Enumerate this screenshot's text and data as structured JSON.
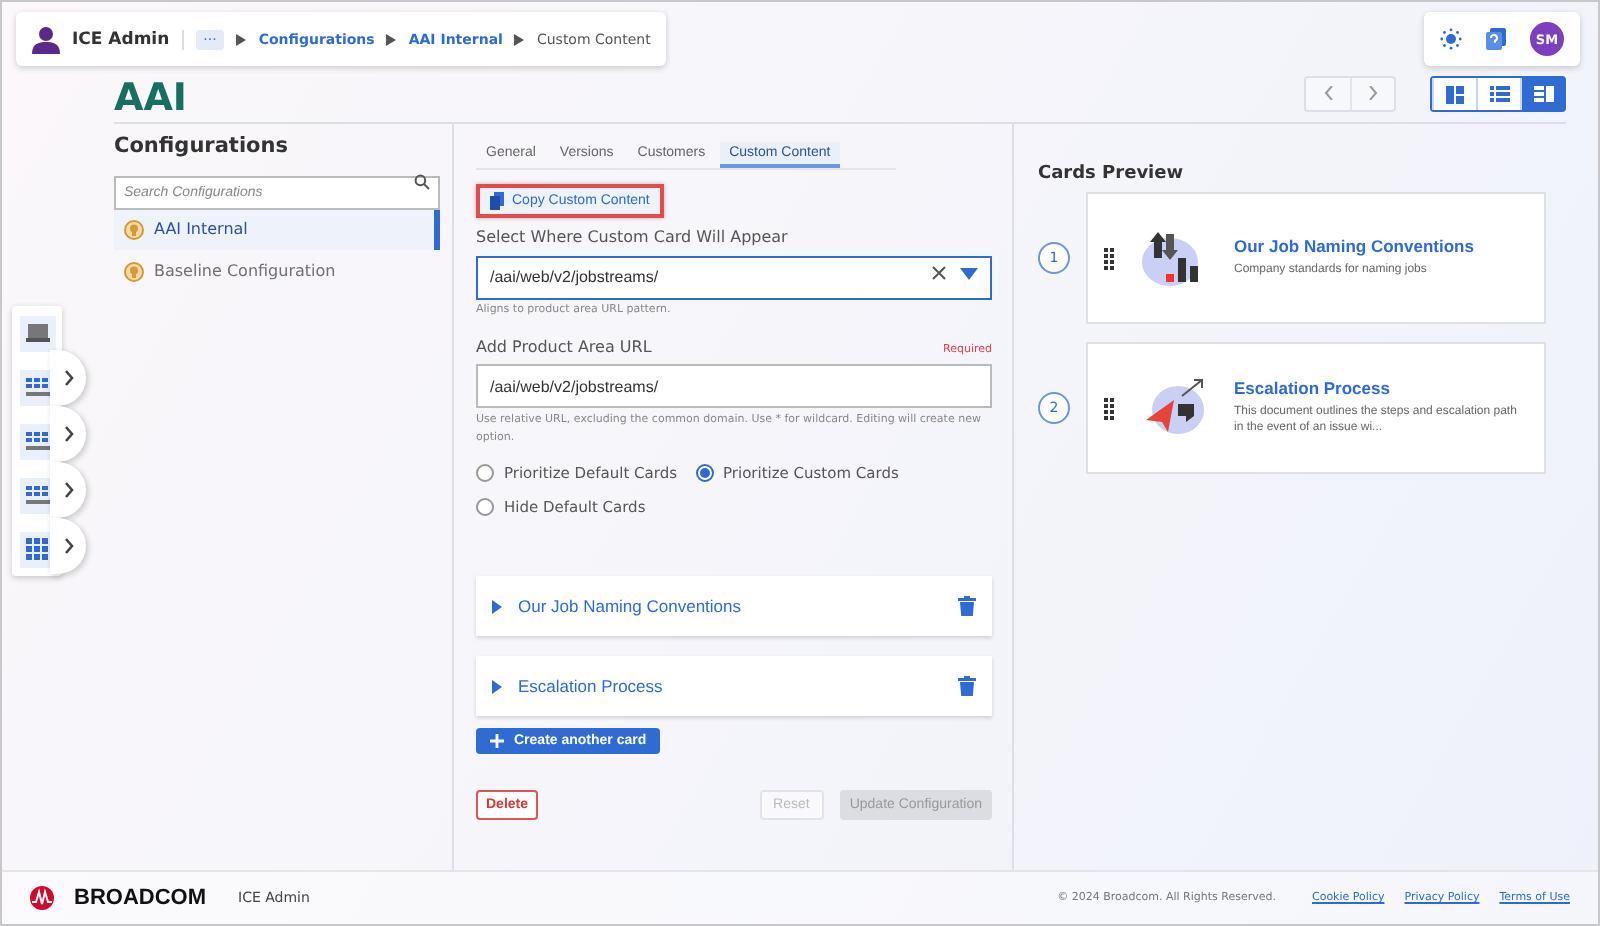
{
  "header": {
    "app_name": "ICE Admin",
    "breadcrumbs": [
      {
        "label": "···",
        "kind": "more"
      },
      {
        "label": "Configurations",
        "kind": "link"
      },
      {
        "label": "AAI Internal",
        "kind": "link"
      },
      {
        "label": "Custom Content",
        "kind": "current"
      }
    ],
    "avatar": "SM"
  },
  "title": "AAI",
  "views": [
    {
      "kind": "tiles",
      "selected": false
    },
    {
      "kind": "list",
      "selected": false
    },
    {
      "kind": "split",
      "selected": true
    }
  ],
  "sidebar": {
    "heading": "Configurations",
    "search": {
      "placeholder": "Search Configurations"
    },
    "items": [
      {
        "label": "AAI Internal",
        "selected": true
      },
      {
        "label": "Baseline Configuration",
        "selected": false
      }
    ]
  },
  "tabs": [
    {
      "label": "General",
      "selected": false
    },
    {
      "label": "Versions",
      "selected": false
    },
    {
      "label": "Customers",
      "selected": false
    },
    {
      "label": "Custom Content",
      "selected": true
    }
  ],
  "copy_button": "Copy Custom Content",
  "placement": {
    "label": "Select Where Custom Card Will Appear",
    "value": "/aai/web/v2/jobstreams/",
    "hint": "Aligns to product area URL pattern."
  },
  "url": {
    "label": "Add Product Area URL",
    "required": "Required",
    "value": "/aai/web/v2/jobstreams/",
    "hint": "Use relative URL, excluding the common domain. Use * for wildcard. Editing will create new option."
  },
  "priority": [
    {
      "label": "Prioritize Default Cards",
      "selected": false
    },
    {
      "label": "Prioritize Custom Cards",
      "selected": true
    },
    {
      "label": "Hide Default Cards",
      "selected": false
    }
  ],
  "cards": [
    {
      "title": "Our Job Naming Conventions",
      "expanded": false
    },
    {
      "title": "Escalation Process",
      "expanded": false
    }
  ],
  "create_button": "Create another card",
  "actions": {
    "delete": "Delete",
    "reset": "Reset",
    "update": "Update Configuration"
  },
  "preview": {
    "heading": "Cards Preview",
    "cards": [
      {
        "number": "1",
        "kind": "chart",
        "title": "Our Job Naming Conventions",
        "text": "Company standards for naming jobs"
      },
      {
        "number": "2",
        "kind": "rocket",
        "title": "Escalation Process",
        "text": "This document outlines the steps and escalation path in the event of an issue wi..."
      }
    ]
  },
  "footer": {
    "brand": "BROADCOM",
    "app": "ICE Admin",
    "copyright": "© 2024 Broadcom. All Rights Reserved.",
    "links": [
      "Cookie Policy",
      "Privacy Policy",
      "Terms of Use"
    ]
  }
}
